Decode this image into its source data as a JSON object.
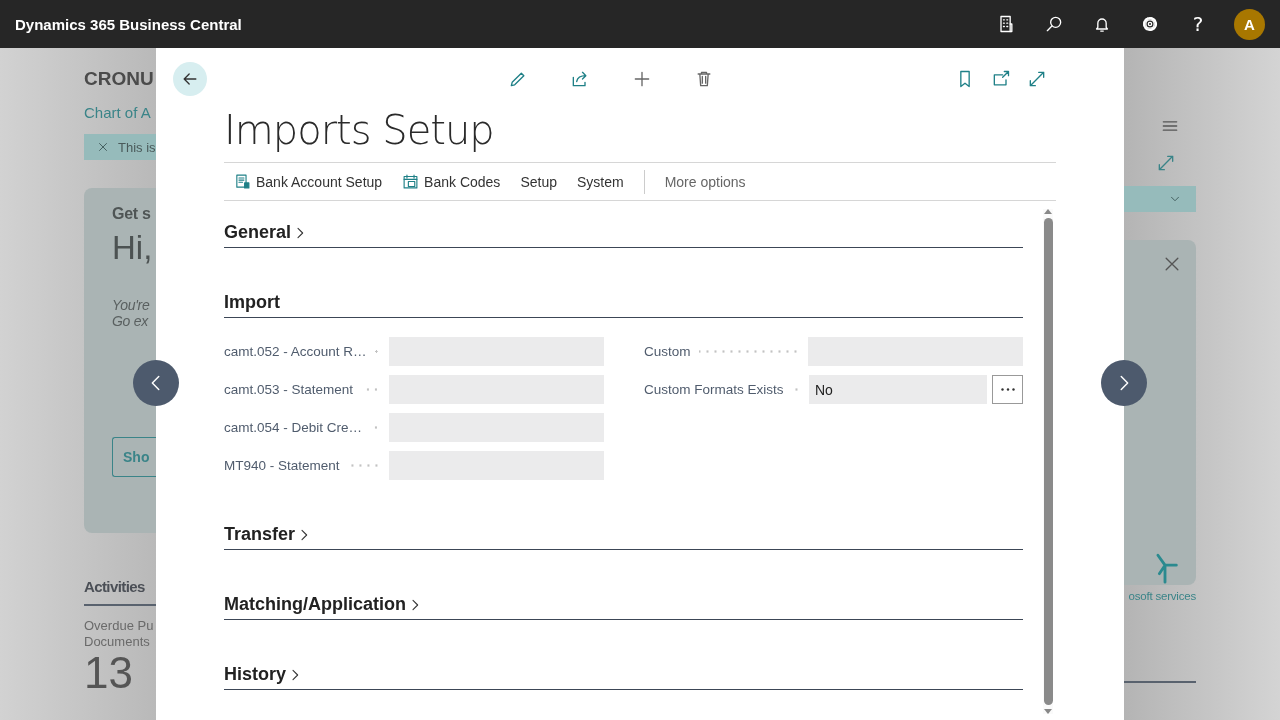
{
  "top_bar": {
    "title": "Dynamics 365 Business Central",
    "help_label": "?",
    "avatar": "A"
  },
  "background": {
    "company": "CRONU",
    "link": "Chart of A",
    "notice": "This is",
    "card": {
      "title": "Get s",
      "greeting": "Hi,",
      "lines": [
        "You're",
        "Go ex"
      ],
      "button": "Sho",
      "caption": "osoft services"
    },
    "activities": {
      "title": "Activities",
      "tile_label": [
        "Overdue Pu",
        "Documents"
      ],
      "tile_value": "13"
    }
  },
  "dialog": {
    "title": "Imports Setup",
    "actions": [
      {
        "label": "Bank Account Setup",
        "kind": "report"
      },
      {
        "label": "Bank Codes",
        "kind": "calendar"
      },
      {
        "label": "Setup",
        "kind": "text"
      },
      {
        "label": "System",
        "kind": "text"
      }
    ],
    "more": "More options",
    "sections": [
      {
        "title": "General",
        "expanded": false
      },
      {
        "title": "Import",
        "expanded": true,
        "left_fields": [
          {
            "label": "camt.052 - Account R…",
            "lookup": false
          },
          {
            "label": "camt.053 - Statement",
            "lookup": false
          },
          {
            "label": "camt.054 - Debit Cre…",
            "lookup": false
          },
          {
            "label": "MT940 - Statement",
            "lookup": false
          }
        ],
        "right_fields": [
          {
            "label": "Custom",
            "lookup": false
          },
          {
            "label": "Custom Formats Exists",
            "value": "No",
            "lookup": true
          }
        ]
      },
      {
        "title": "Transfer",
        "expanded": false
      },
      {
        "title": "Matching/Application",
        "expanded": false
      },
      {
        "title": "History",
        "expanded": false
      }
    ]
  }
}
